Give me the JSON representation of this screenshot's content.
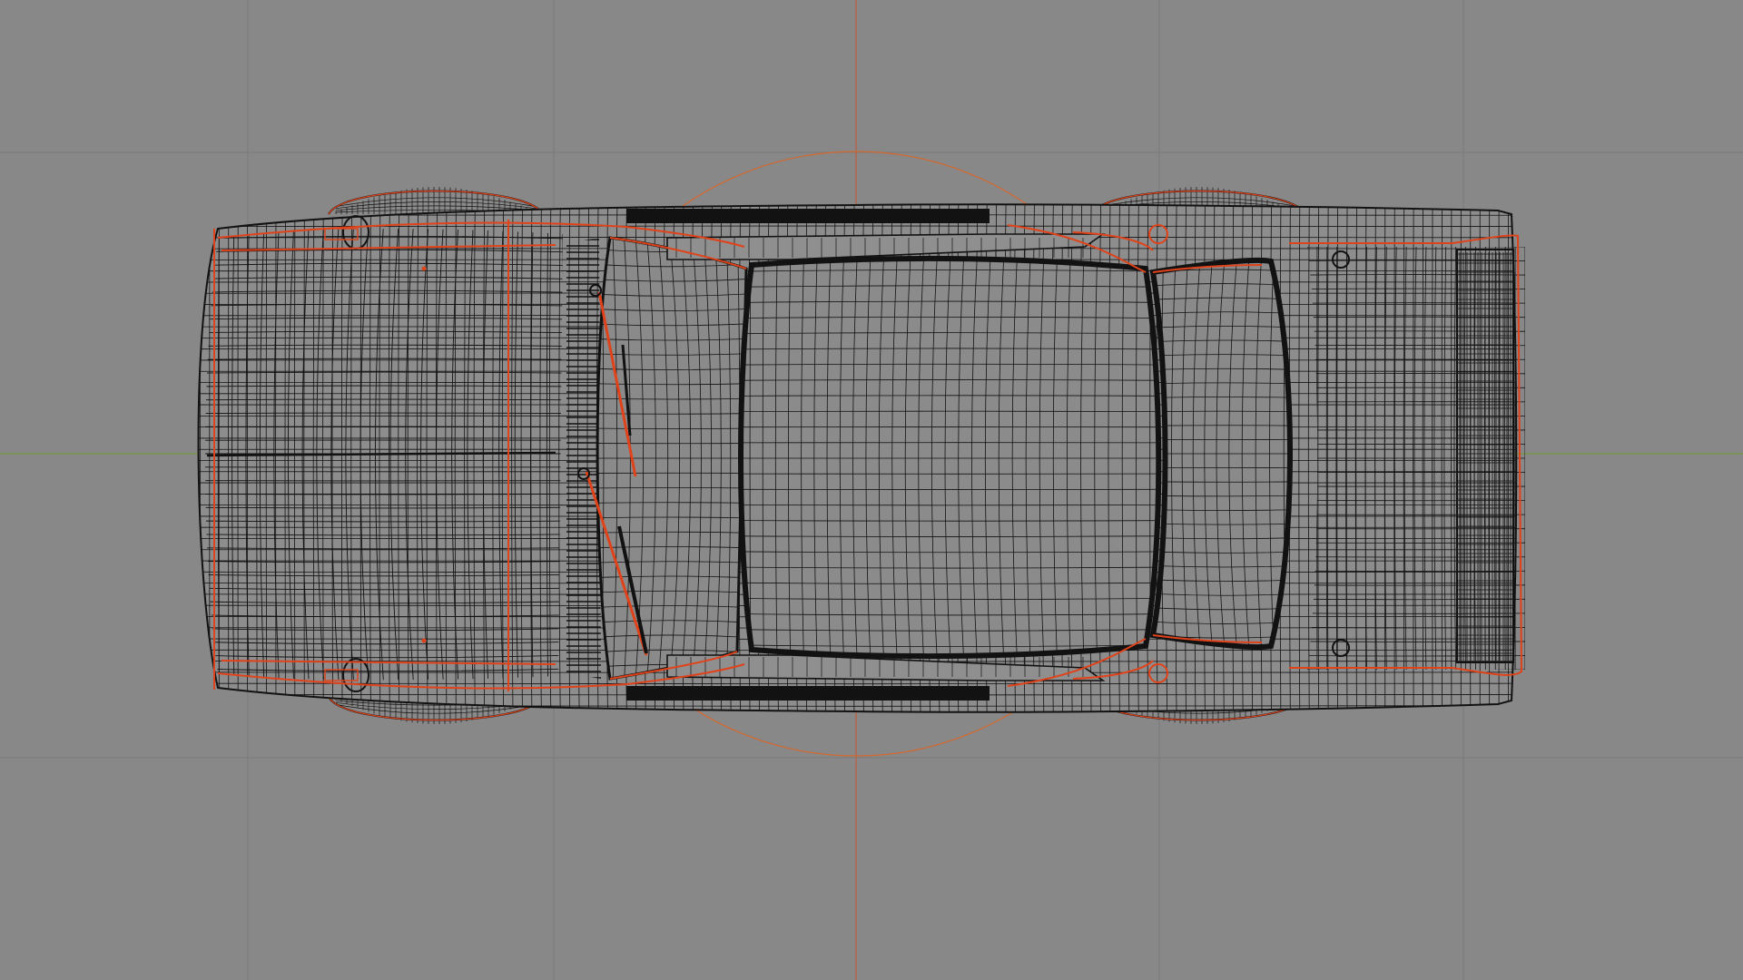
{
  "viewport": {
    "view": "top-orthographic",
    "background_color": "#888888",
    "grid_color": "#7a7a7a",
    "x_axis_color": "#6f9c2e",
    "y_axis_color": "#c8552a",
    "wire_color": "#121212",
    "selection_color": "#e0421a",
    "pivot_circle_color": "#d4682e",
    "model": {
      "object": "car-body-wireframe",
      "shading": "wireframe",
      "selected": true
    }
  }
}
